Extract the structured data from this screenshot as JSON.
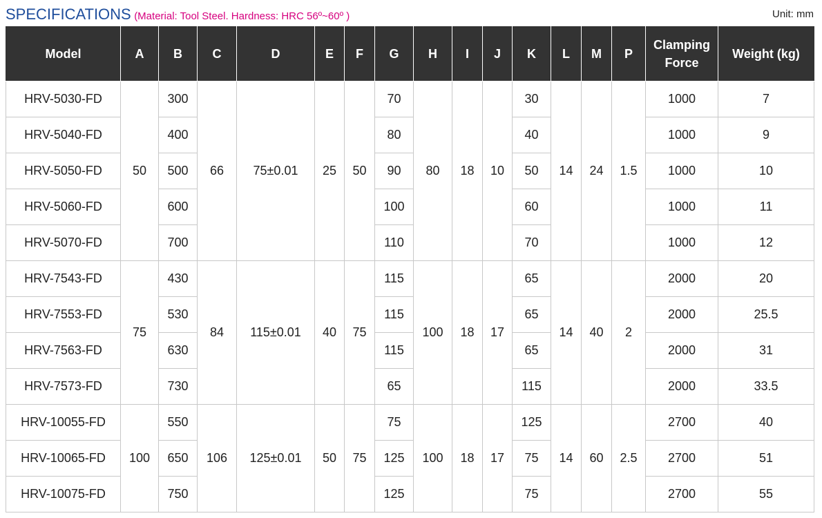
{
  "title": "SPECIFICATIONS",
  "subtitle": "(Material: Tool Steel. Hardness: HRC 56º~60º )",
  "unit": "Unit: mm",
  "headers": {
    "model": "Model",
    "a": "A",
    "b": "B",
    "c": "C",
    "d": "D",
    "e": "E",
    "f": "F",
    "g": "G",
    "h": "H",
    "i": "I",
    "j": "J",
    "k": "K",
    "l": "L",
    "m": "M",
    "p": "P",
    "clamping_line1": "Clamping",
    "clamping_line2": "Force",
    "weight": "Weight (kg)"
  },
  "groups": [
    {
      "a": "50",
      "c": "66",
      "d": "75±0.01",
      "e": "25",
      "f": "50",
      "h": "80",
      "i": "18",
      "j": "10",
      "l": "14",
      "m": "24",
      "p": "1.5",
      "rows": [
        {
          "model": "HRV-5030-FD",
          "b": "300",
          "g": "70",
          "k": "30",
          "force": "1000",
          "weight": "7"
        },
        {
          "model": "HRV-5040-FD",
          "b": "400",
          "g": "80",
          "k": "40",
          "force": "1000",
          "weight": "9"
        },
        {
          "model": "HRV-5050-FD",
          "b": "500",
          "g": "90",
          "k": "50",
          "force": "1000",
          "weight": "10"
        },
        {
          "model": "HRV-5060-FD",
          "b": "600",
          "g": "100",
          "k": "60",
          "force": "1000",
          "weight": "11"
        },
        {
          "model": "HRV-5070-FD",
          "b": "700",
          "g": "110",
          "k": "70",
          "force": "1000",
          "weight": "12"
        }
      ]
    },
    {
      "a": "75",
      "c": "84",
      "d": "115±0.01",
      "e": "40",
      "f": "75",
      "h": "100",
      "i": "18",
      "j": "17",
      "l": "14",
      "m": "40",
      "p": "2",
      "rows": [
        {
          "model": "HRV-7543-FD",
          "b": "430",
          "g": "115",
          "k": "65",
          "force": "2000",
          "weight": "20"
        },
        {
          "model": "HRV-7553-FD",
          "b": "530",
          "g": "115",
          "k": "65",
          "force": "2000",
          "weight": "25.5"
        },
        {
          "model": "HRV-7563-FD",
          "b": "630",
          "g": "115",
          "k": "65",
          "force": "2000",
          "weight": "31"
        },
        {
          "model": "HRV-7573-FD",
          "b": "730",
          "g": "65",
          "k": "115",
          "force": "2000",
          "weight": "33.5"
        }
      ]
    },
    {
      "a": "100",
      "c": "106",
      "d": "125±0.01",
      "e": "50",
      "f": "75",
      "h": "100",
      "i": "18",
      "j": "17",
      "l": "14",
      "m": "60",
      "p": "2.5",
      "rows": [
        {
          "model": "HRV-10055-FD",
          "b": "550",
          "g": "75",
          "k": "125",
          "force": "2700",
          "weight": "40"
        },
        {
          "model": "HRV-10065-FD",
          "b": "650",
          "g": "125",
          "k": "75",
          "force": "2700",
          "weight": "51"
        },
        {
          "model": "HRV-10075-FD",
          "b": "750",
          "g": "125",
          "k": "75",
          "force": "2700",
          "weight": "55"
        }
      ]
    }
  ]
}
